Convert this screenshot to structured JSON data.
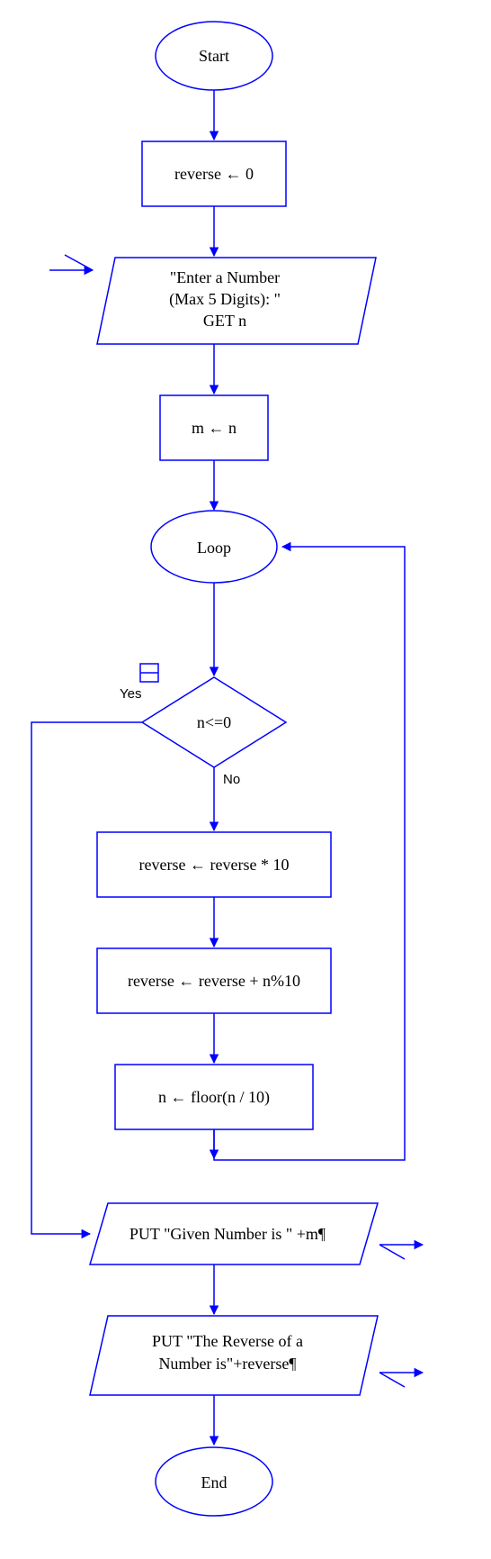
{
  "flowchart": {
    "start": "Start",
    "init": "reverse ← 0",
    "input_line1": "\"Enter a Number",
    "input_line2": "(Max 5 Digits): \"",
    "input_line3": "GET n",
    "copy": "m ← n",
    "loop": "Loop",
    "cond": "n<=0",
    "cond_yes": "Yes",
    "cond_no": "No",
    "step1": "reverse ← reverse * 10",
    "step2": "reverse ← reverse + n%10",
    "step3": "n ← floor(n / 10)",
    "out1": "PUT \"Given Number is \" +m¶",
    "out2_line1": "PUT \"The Reverse of a",
    "out2_line2": "Number is\"+reverse¶",
    "end": "End"
  },
  "colors": {
    "stroke": "#0000ff",
    "bg": "#ffffff"
  }
}
